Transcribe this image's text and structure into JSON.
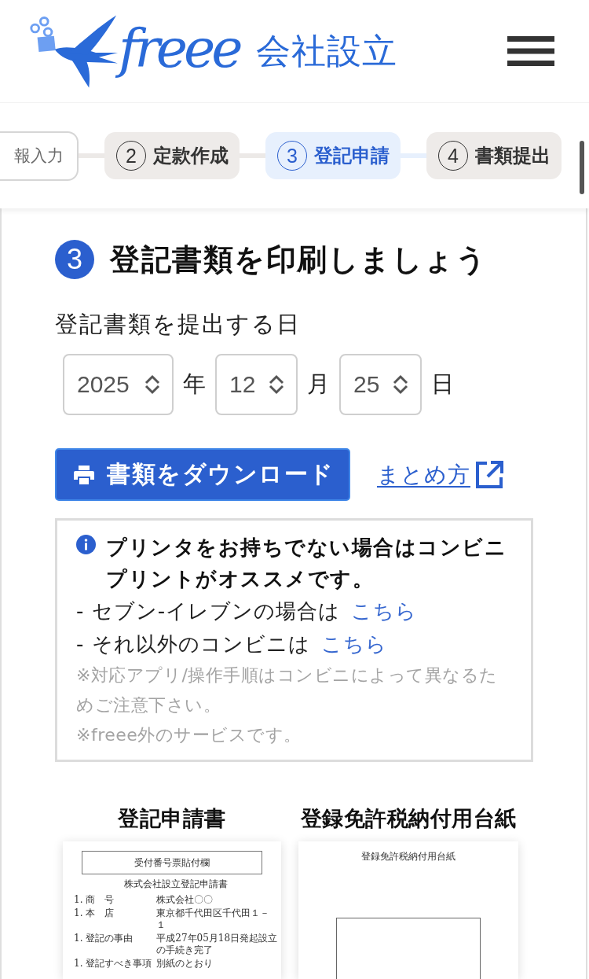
{
  "header": {
    "logo_word": "freee",
    "logo_suffix": "会社設立"
  },
  "steps": [
    {
      "label": "報入力",
      "selected": false,
      "disabled": true
    },
    {
      "number": "2",
      "label": "定款作成",
      "selected": false,
      "disabled": false
    },
    {
      "number": "3",
      "label": "登記申請",
      "selected": true,
      "disabled": false
    },
    {
      "number": "4",
      "label": "書類提出",
      "selected": false,
      "disabled": false
    }
  ],
  "section": {
    "number": "3",
    "title": "登記書類を印刷しましょう"
  },
  "date": {
    "label": "登記書類を提出する日",
    "fields": [
      {
        "value": "2025",
        "unit": "年"
      },
      {
        "value": "12",
        "unit": "月"
      },
      {
        "value": "25",
        "unit": "日"
      }
    ]
  },
  "download_button": {
    "label": "書類をダウンロード"
  },
  "guide_link": {
    "label": "まとめ方"
  },
  "notice": {
    "heading": "プリンタをお持ちでない場合はコンビニプリントがオススメです。",
    "lines": [
      {
        "text": "- セブン-イレブンの場合は",
        "link": "こちら"
      },
      {
        "text": "- それ以外のコンビニは",
        "link": "こちら"
      }
    ],
    "notes": [
      "※対応アプリ/操作手順はコンビニによって異なるためご注意下さい。",
      "※freee外のサービスです。"
    ]
  },
  "documents": [
    {
      "title": "登記申請書",
      "kind": "application",
      "preview": {
        "box_label": "受付番号票貼付欄",
        "heading": "株式会社設立登記申請書",
        "rows": [
          {
            "label": "1. 商　号",
            "value": "株式会社〇〇"
          },
          {
            "label": "1. 本　店",
            "value": "東京都千代田区千代田１－１"
          },
          {
            "label": "1. 登記の事由",
            "value": "平成27年05月18日発起設立の手続き完了"
          },
          {
            "label": "1. 登記すべき事項",
            "value": "別紙のとおり"
          }
        ]
      }
    },
    {
      "title": "登録免許税納付用台紙",
      "kind": "stamp_sheet",
      "preview": {
        "heading": "登録免許税納付用台紙"
      }
    }
  ]
}
